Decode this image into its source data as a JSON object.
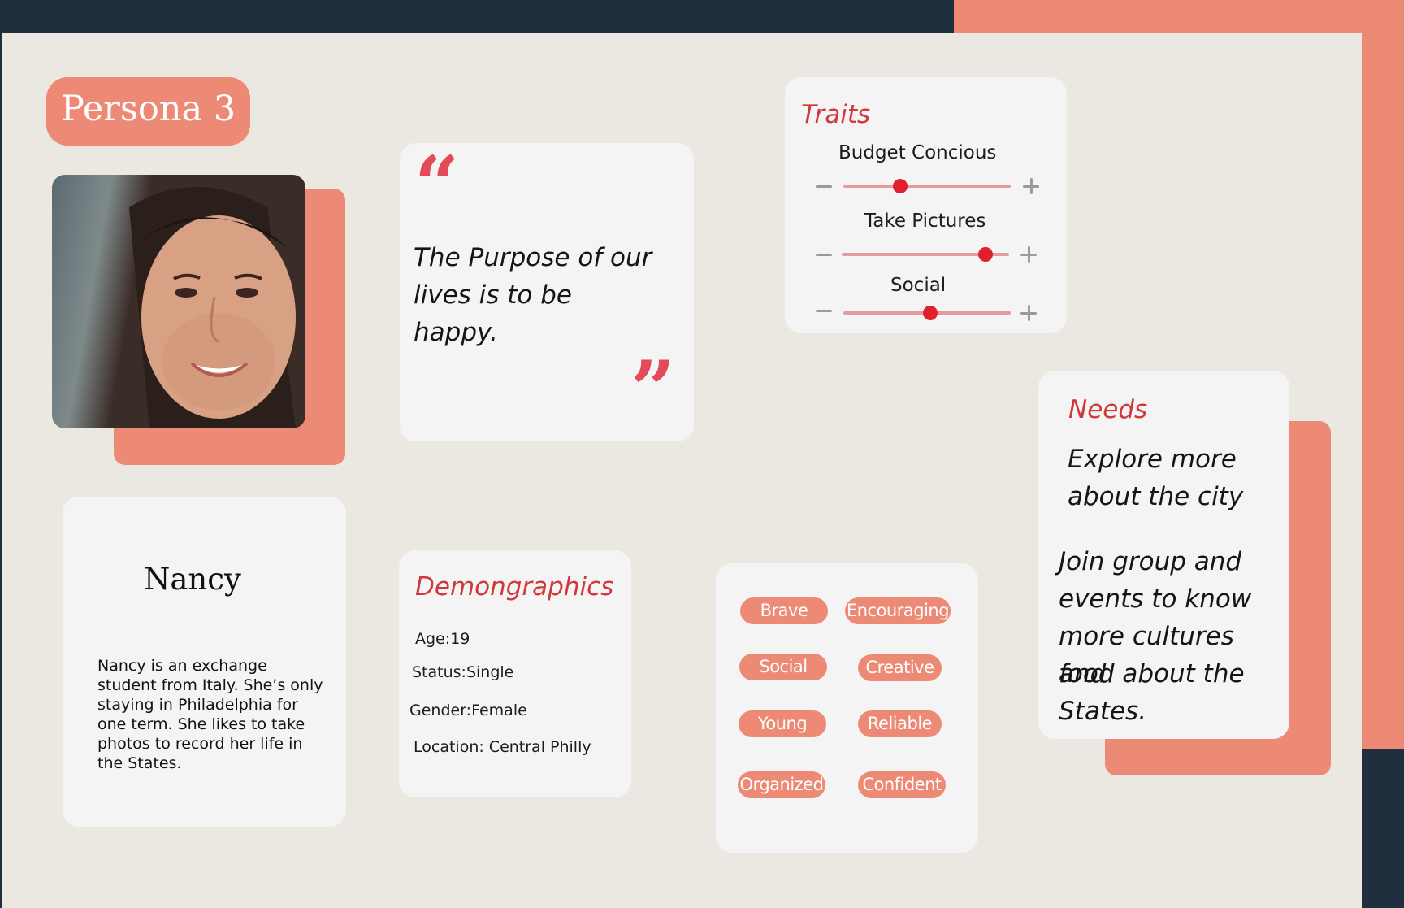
{
  "persona": {
    "title": "Persona 3"
  },
  "quote": {
    "open_mark": "“",
    "close_mark": "”",
    "text": "The Purpose of our lives is to be happy."
  },
  "traits": {
    "title": "Traits",
    "items": [
      {
        "label": "Budget Concious",
        "value": 0.34
      },
      {
        "label": "Take Pictures",
        "value": 0.86
      },
      {
        "label": "Social",
        "value": 0.52
      }
    ]
  },
  "profile": {
    "name": "Nancy",
    "bio": "Nancy is an exchange student from Italy. She’s only staying in Philadelphia for one term. She likes to take photos to record her life in the States."
  },
  "demographics": {
    "title": "Demongraphics",
    "age": "Age:19",
    "status": "Status:Single",
    "gender": "Gender:Female",
    "location": "Location: Central Philly"
  },
  "tags": [
    "Brave",
    "Encouraging",
    "Social",
    "Creative",
    "Young",
    "Reliable",
    "Organized",
    "Confident"
  ],
  "needs": {
    "title": "Needs",
    "item1_line1": "Explore more",
    "item1_line2": "about the city",
    "item2_line1": "Join group and",
    "item2_line2": "events to know",
    "item2_line3": "more cultures and",
    "item2_line4": "food about the",
    "item2_line5": "States."
  },
  "colors": {
    "background": "#ebe8e1",
    "accent": "#ec8a75",
    "dark": "#1f2f3d",
    "title_red": "#d0383d",
    "quote_mark": "#e34a5a",
    "slider_thumb": "#e0202c"
  }
}
